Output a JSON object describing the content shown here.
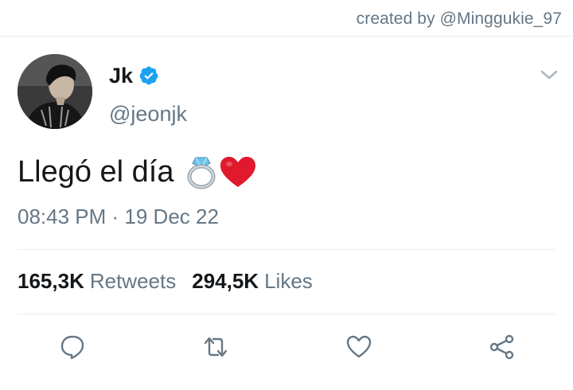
{
  "credit": "created by @Minggukie_97",
  "tweet": {
    "author_name": "Jk",
    "author_handle": "@jeonjk",
    "text": "Llegó el día",
    "emojis": [
      "ring-emoji",
      "red-heart-emoji"
    ],
    "timestamp": "08:43 PM · 19 Dec 22",
    "retweets_count": "165,3K",
    "retweets_label": "Retweets",
    "likes_count": "294,5K",
    "likes_label": "Likes"
  },
  "icons": {
    "verified": "verified-badge-icon",
    "menu": "chevron-down-icon",
    "reply": "reply-icon",
    "retweet": "retweet-icon",
    "like": "heart-icon",
    "share": "share-icon"
  },
  "colors": {
    "text": "#14171a",
    "secondary": "#657786",
    "verified": "#1da1f2",
    "divider": "#e6ecf0",
    "heart_emoji": "#e0192d"
  }
}
